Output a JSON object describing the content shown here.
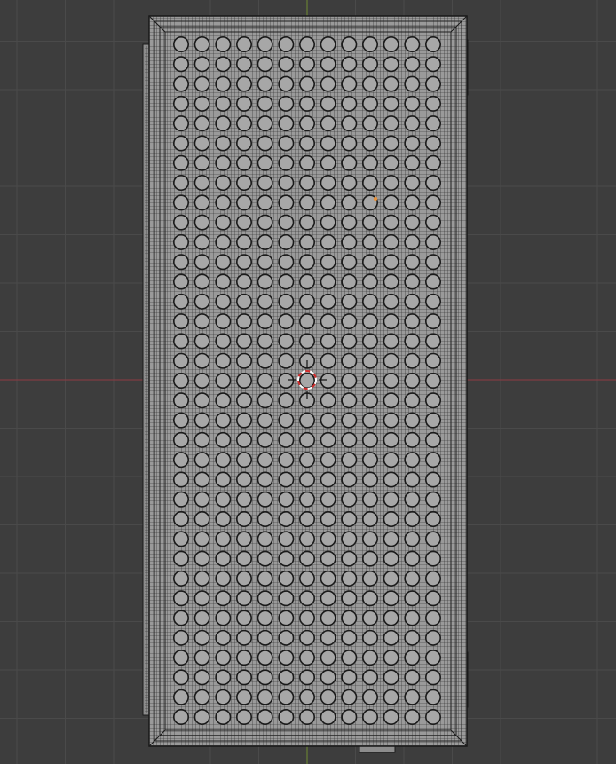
{
  "viewport": {
    "view": "top-orthographic",
    "background_color": "#3d3d3d",
    "grid_minor_color": "#444444",
    "grid_major_color": "#4a4a4a",
    "axis_x_color": "#8f3b43",
    "axis_y_color": "#6e8a31",
    "grid": true
  },
  "mesh": {
    "type": "perforated-panel",
    "mode": "edit-wireframe",
    "fill_color": "#9a9a9a",
    "wire_color": "#202020",
    "hole_color": "#a7a7a7",
    "hole_rim_color": "#1a1a1a",
    "hole_columns": 13,
    "hole_rows": 35,
    "selected_vertex_color": "#e8913a"
  },
  "cursor_3d": {
    "type": "3d-cursor",
    "ring_colors": [
      "#ffffff",
      "#d22b2b"
    ]
  }
}
